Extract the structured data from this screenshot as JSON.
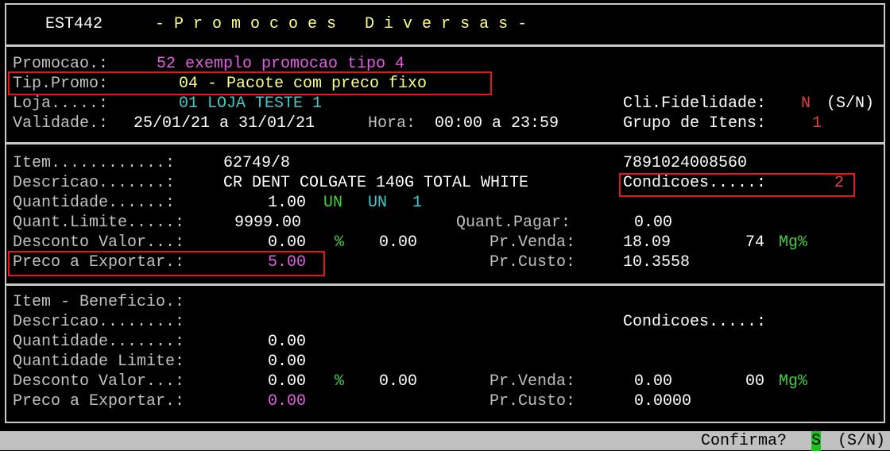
{
  "title": {
    "code": "EST442",
    "name": "- P r o m o c o e s   D i v e r s a s -"
  },
  "header": {
    "promocao_label": "Promocao.:",
    "promocao_value": "52 exemplo promocao tipo 4",
    "tipo_label": "Tip.Promo:",
    "tipo_value": "04 - Pacote com preco fixo",
    "loja_label": "Loja.....:",
    "loja_value": "01 LOJA TESTE 1",
    "fidelidade_label": "Cli.Fidelidade:",
    "fidelidade_value": "N",
    "fidelidade_opts": "(S/N)",
    "validade_label": "Validade.:",
    "validade_value": "25/01/21 a 31/01/21",
    "hora_label": "Hora:",
    "hora_value": "00:00 a 23:59",
    "grupo_label": "Grupo de Itens:",
    "grupo_value": "1"
  },
  "item": {
    "item_label": "Item............:",
    "item_value": "62749/8",
    "ean": "7891024008560",
    "descricao_label": "Descricao.......:",
    "descricao_value": "CR DENT COLGATE 140G TOTAL WHITE",
    "condicoes_label": "Condicoes.....:",
    "condicoes_value": "2",
    "quantidade_label": "Quantidade......:",
    "quantidade_value": "1.00",
    "un1": "UN",
    "un2": "UN",
    "un_qty": "1",
    "quant_limite_label": "Quant.Limite.....:",
    "quant_limite_value": "9999.00",
    "quant_pagar_label": "Quant.Pagar:",
    "quant_pagar_value": "0.00",
    "desconto_label": "Desconto Valor...:",
    "desconto_value": "0.00",
    "pct": "%",
    "desconto_pct_value": "0.00",
    "pr_venda_label": "Pr.Venda:",
    "pr_venda_value": "18.09",
    "mg_value": "74",
    "mg_label": "Mg%",
    "preco_export_label": "Preco a Exportar.:",
    "preco_export_value": "5.00",
    "pr_custo_label": "Pr.Custo:",
    "pr_custo_value": "10.3558"
  },
  "beneficio": {
    "item_label": "Item - Beneficio.:",
    "descricao_label": "Descricao........:",
    "condicoes_label": "Condicoes.....:",
    "quantidade_label": "Quantidade.......:",
    "quantidade_value": "0.00",
    "quant_limite_label": "Quantidade Limite:",
    "quant_limite_value": "0.00",
    "desconto_label": "Desconto Valor...:",
    "desconto_value": "0.00",
    "pct": "%",
    "desconto_pct_value": "0.00",
    "pr_venda_label": "Pr.Venda:",
    "pr_venda_value": "0.00",
    "mg_value": "00",
    "mg_label": "Mg%",
    "preco_export_label": "Preco a Exportar.:",
    "preco_export_value": "0.00",
    "pr_custo_label": "Pr.Custo:",
    "pr_custo_value": "0.0000"
  },
  "status": {
    "confirma_label": "Confirma?",
    "confirma_value": "S",
    "confirma_opts": "(S/N)"
  }
}
